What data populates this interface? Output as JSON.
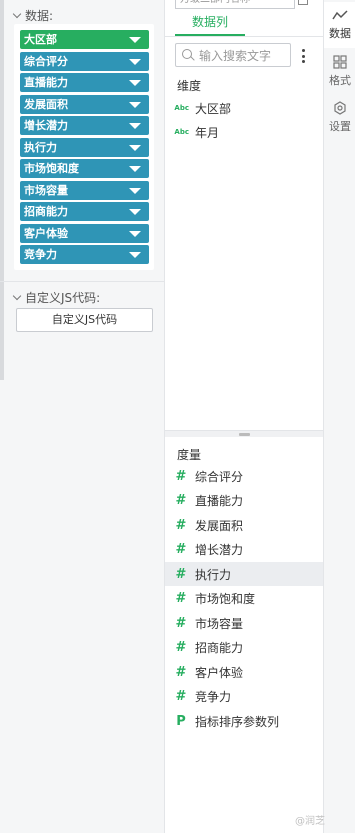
{
  "config": {
    "data_label": "数据:",
    "data_fields": [
      "大区部",
      "综合评分",
      "直播能力",
      "发展面积",
      "增长潜力",
      "执行力",
      "市场饱和度",
      "市场容量",
      "招商能力",
      "客户体验",
      "竞争力"
    ],
    "custom_js_label": "自定义JS代码:",
    "custom_js_button": "自定义JS代码"
  },
  "fields_panel": {
    "top_combo_text": "万级二部门名称",
    "tab_label": "数据列",
    "search_placeholder": "输入搜索文字",
    "dimension_title": "维度",
    "dimension_icon_text": "Abc",
    "dimensions": [
      "大区部",
      "年月"
    ],
    "measure_title": "度量",
    "measure_icon_text": "#",
    "measures": [
      "综合评分",
      "直播能力",
      "发展面积",
      "增长潜力",
      "执行力",
      "市场饱和度",
      "市场容量",
      "招商能力",
      "客户体验",
      "竞争力"
    ],
    "selected_measure": "执行力",
    "param_icon_text": "P",
    "param_item": "指标排序参数列"
  },
  "side_tabs": {
    "data": "数据",
    "format": "格式",
    "settings": "设置"
  },
  "watermark": "@润芝"
}
